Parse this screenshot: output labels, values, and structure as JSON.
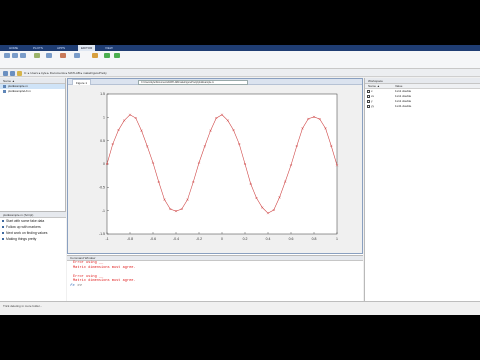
{
  "ribbon": {
    "tabs": [
      "HOME",
      "PLOTS",
      "APPS",
      "EDITOR",
      "VIEW"
    ],
    "active": "EDITOR"
  },
  "toolbar": {
    "path_parts": [
      "C:",
      "Users",
      "kyle",
      "Documents",
      "MATLAB",
      "makeFigurePretty"
    ]
  },
  "current_folder": {
    "header": "Name ▲",
    "files": [
      {
        "name": "plotExample.m",
        "selected": true
      },
      {
        "name": "plotExampleUI.m",
        "selected": false
      }
    ]
  },
  "details": {
    "title": "plotExample.m (Script)",
    "items": [
      "Start with some fake data",
      "Follow up with markers",
      "Next work on finding values",
      "Making things pretty"
    ]
  },
  "figure": {
    "tab": "Figure 1",
    "path": "C:\\Users\\kyle\\Documents\\MATLAB\\makeFigurePretty\\plotExample.m"
  },
  "chart_data": {
    "type": "line",
    "x_start": -1,
    "x_end": 1,
    "x_step": 0.05,
    "function": "cos(2.5*pi*x) with noise",
    "marker": "x",
    "color": "#d04848",
    "xlim": [
      -1,
      1
    ],
    "ylim": [
      -1.5,
      1.5
    ],
    "xticks": [
      "-1",
      "-0.8",
      "-0.6",
      "-0.4",
      "-0.2",
      "0",
      "0.2",
      "0.4",
      "0.6",
      "0.8",
      "1"
    ],
    "yticks": [
      "1.5",
      "1",
      "0.5",
      "0",
      "-0.5",
      "-1",
      "-1.5"
    ]
  },
  "command_window": {
    "title": "Command Window",
    "lines": [
      {
        "text": "Error using __",
        "style": "err"
      },
      {
        "text": "Matrix dimensions must agree.",
        "style": "err"
      },
      {
        "text": "",
        "style": ""
      },
      {
        "text": "Error using __",
        "style": "err"
      },
      {
        "text": "Matrix dimensions must agree.",
        "style": "err"
      }
    ],
    "prompt": ">>"
  },
  "workspace": {
    "title": "Workspace",
    "columns": [
      "Name ▲",
      "Value"
    ],
    "rows": [
      {
        "name": "x",
        "value": "1x11 double"
      },
      {
        "name": "xx",
        "value": "1x11 double"
      },
      {
        "name": "y",
        "value": "1x11 double"
      },
      {
        "name": "yy",
        "value": "1x41 double"
      }
    ]
  },
  "status": {
    "text": "Trick deleting in more folder..."
  }
}
